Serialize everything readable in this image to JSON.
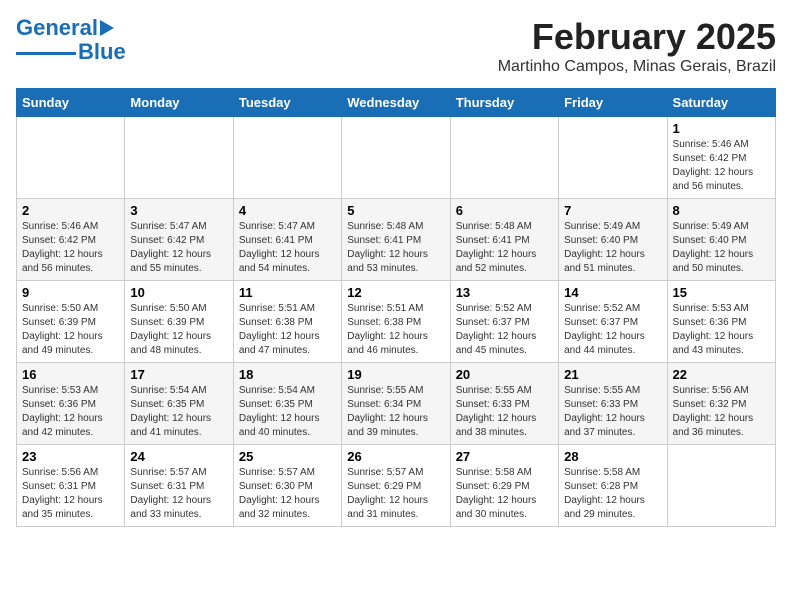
{
  "header": {
    "logo_line1": "General",
    "logo_line2": "Blue",
    "title": "February 2025",
    "subtitle": "Martinho Campos, Minas Gerais, Brazil"
  },
  "weekdays": [
    "Sunday",
    "Monday",
    "Tuesday",
    "Wednesday",
    "Thursday",
    "Friday",
    "Saturday"
  ],
  "weeks": [
    [
      {
        "day": "",
        "info": ""
      },
      {
        "day": "",
        "info": ""
      },
      {
        "day": "",
        "info": ""
      },
      {
        "day": "",
        "info": ""
      },
      {
        "day": "",
        "info": ""
      },
      {
        "day": "",
        "info": ""
      },
      {
        "day": "1",
        "info": "Sunrise: 5:46 AM\nSunset: 6:42 PM\nDaylight: 12 hours\nand 56 minutes."
      }
    ],
    [
      {
        "day": "2",
        "info": "Sunrise: 5:46 AM\nSunset: 6:42 PM\nDaylight: 12 hours\nand 56 minutes."
      },
      {
        "day": "3",
        "info": "Sunrise: 5:47 AM\nSunset: 6:42 PM\nDaylight: 12 hours\nand 55 minutes."
      },
      {
        "day": "4",
        "info": "Sunrise: 5:47 AM\nSunset: 6:41 PM\nDaylight: 12 hours\nand 54 minutes."
      },
      {
        "day": "5",
        "info": "Sunrise: 5:48 AM\nSunset: 6:41 PM\nDaylight: 12 hours\nand 53 minutes."
      },
      {
        "day": "6",
        "info": "Sunrise: 5:48 AM\nSunset: 6:41 PM\nDaylight: 12 hours\nand 52 minutes."
      },
      {
        "day": "7",
        "info": "Sunrise: 5:49 AM\nSunset: 6:40 PM\nDaylight: 12 hours\nand 51 minutes."
      },
      {
        "day": "8",
        "info": "Sunrise: 5:49 AM\nSunset: 6:40 PM\nDaylight: 12 hours\nand 50 minutes."
      }
    ],
    [
      {
        "day": "9",
        "info": "Sunrise: 5:50 AM\nSunset: 6:39 PM\nDaylight: 12 hours\nand 49 minutes."
      },
      {
        "day": "10",
        "info": "Sunrise: 5:50 AM\nSunset: 6:39 PM\nDaylight: 12 hours\nand 48 minutes."
      },
      {
        "day": "11",
        "info": "Sunrise: 5:51 AM\nSunset: 6:38 PM\nDaylight: 12 hours\nand 47 minutes."
      },
      {
        "day": "12",
        "info": "Sunrise: 5:51 AM\nSunset: 6:38 PM\nDaylight: 12 hours\nand 46 minutes."
      },
      {
        "day": "13",
        "info": "Sunrise: 5:52 AM\nSunset: 6:37 PM\nDaylight: 12 hours\nand 45 minutes."
      },
      {
        "day": "14",
        "info": "Sunrise: 5:52 AM\nSunset: 6:37 PM\nDaylight: 12 hours\nand 44 minutes."
      },
      {
        "day": "15",
        "info": "Sunrise: 5:53 AM\nSunset: 6:36 PM\nDaylight: 12 hours\nand 43 minutes."
      }
    ],
    [
      {
        "day": "16",
        "info": "Sunrise: 5:53 AM\nSunset: 6:36 PM\nDaylight: 12 hours\nand 42 minutes."
      },
      {
        "day": "17",
        "info": "Sunrise: 5:54 AM\nSunset: 6:35 PM\nDaylight: 12 hours\nand 41 minutes."
      },
      {
        "day": "18",
        "info": "Sunrise: 5:54 AM\nSunset: 6:35 PM\nDaylight: 12 hours\nand 40 minutes."
      },
      {
        "day": "19",
        "info": "Sunrise: 5:55 AM\nSunset: 6:34 PM\nDaylight: 12 hours\nand 39 minutes."
      },
      {
        "day": "20",
        "info": "Sunrise: 5:55 AM\nSunset: 6:33 PM\nDaylight: 12 hours\nand 38 minutes."
      },
      {
        "day": "21",
        "info": "Sunrise: 5:55 AM\nSunset: 6:33 PM\nDaylight: 12 hours\nand 37 minutes."
      },
      {
        "day": "22",
        "info": "Sunrise: 5:56 AM\nSunset: 6:32 PM\nDaylight: 12 hours\nand 36 minutes."
      }
    ],
    [
      {
        "day": "23",
        "info": "Sunrise: 5:56 AM\nSunset: 6:31 PM\nDaylight: 12 hours\nand 35 minutes."
      },
      {
        "day": "24",
        "info": "Sunrise: 5:57 AM\nSunset: 6:31 PM\nDaylight: 12 hours\nand 33 minutes."
      },
      {
        "day": "25",
        "info": "Sunrise: 5:57 AM\nSunset: 6:30 PM\nDaylight: 12 hours\nand 32 minutes."
      },
      {
        "day": "26",
        "info": "Sunrise: 5:57 AM\nSunset: 6:29 PM\nDaylight: 12 hours\nand 31 minutes."
      },
      {
        "day": "27",
        "info": "Sunrise: 5:58 AM\nSunset: 6:29 PM\nDaylight: 12 hours\nand 30 minutes."
      },
      {
        "day": "28",
        "info": "Sunrise: 5:58 AM\nSunset: 6:28 PM\nDaylight: 12 hours\nand 29 minutes."
      },
      {
        "day": "",
        "info": ""
      }
    ]
  ]
}
